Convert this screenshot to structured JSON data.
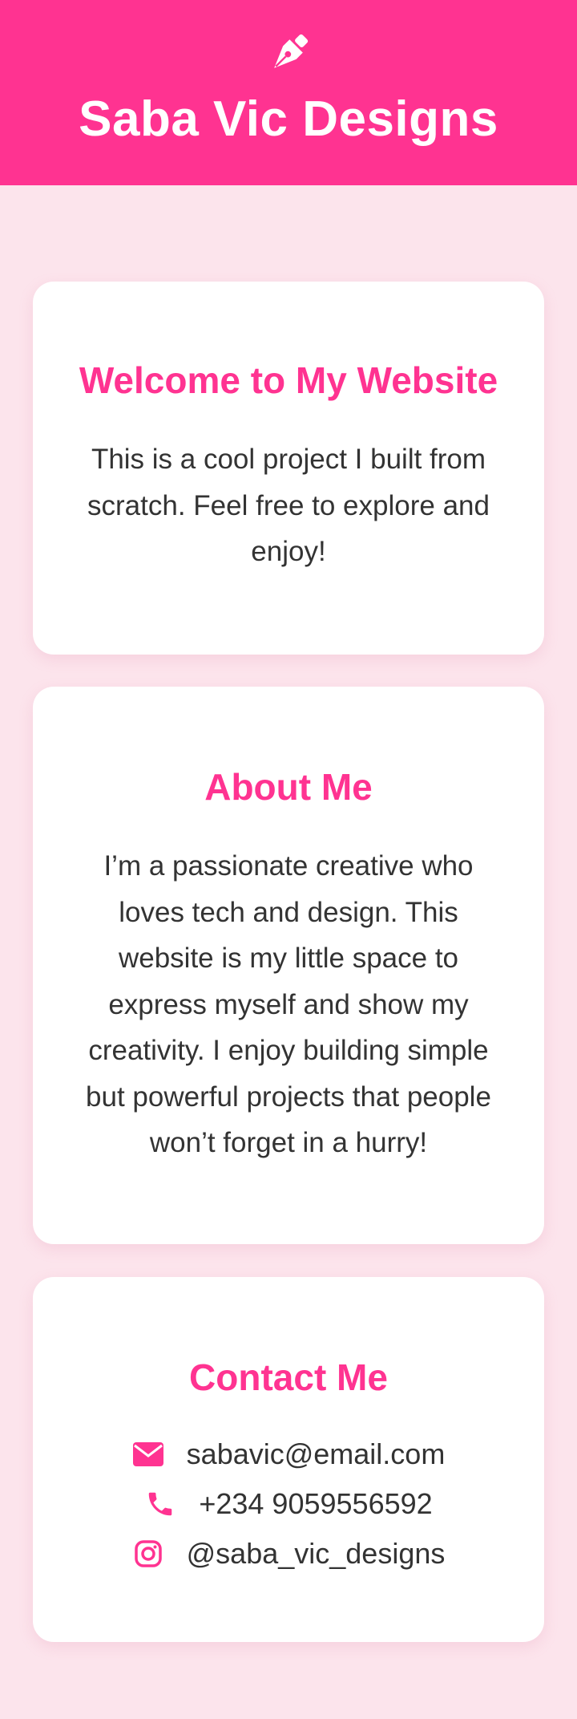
{
  "header": {
    "title": "Saba Vic Designs",
    "icon": "pen-nib-icon"
  },
  "welcome": {
    "heading": "Welcome to My Website",
    "text": "This is a cool project I built from scratch. Feel free to explore and enjoy!"
  },
  "about": {
    "heading": "About Me",
    "text": "I’m a passionate creative who loves tech and design. This website is my little space to express myself and show my creativity. I enjoy building simple but powerful projects that people won’t forget in a hurry!"
  },
  "contact": {
    "heading": "Contact Me",
    "items": [
      {
        "icon": "envelope-icon",
        "value": "sabavic@email.com"
      },
      {
        "icon": "phone-icon",
        "value": "+234 9059556592"
      },
      {
        "icon": "instagram-icon",
        "value": "@saba_vic_designs"
      }
    ]
  },
  "colors": {
    "accent": "#ff3391",
    "page_background": "#fce4ec",
    "card_background": "#ffffff",
    "text": "#333333"
  }
}
